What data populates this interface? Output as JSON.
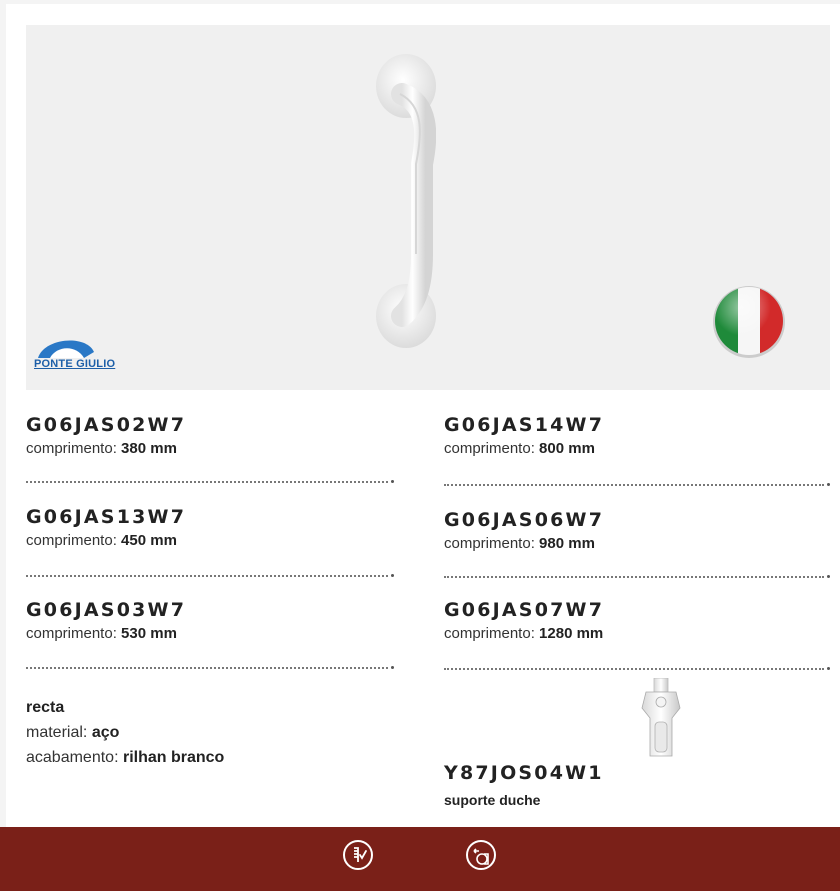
{
  "brand": {
    "logo_text": "PONTE GIULIO",
    "colors": {
      "footer": "#7a2018",
      "logo": "#1d5fa8"
    }
  },
  "products_left": [
    {
      "code": "G06JAS02W7",
      "label": "comprimento:",
      "value": "380 mm"
    },
    {
      "code": "G06JAS13W7",
      "label": "comprimento:",
      "value": "450 mm"
    },
    {
      "code": "G06JAS03W7",
      "label": "comprimento:",
      "value": "530 mm"
    }
  ],
  "products_right": [
    {
      "code": "G06JAS14W7",
      "label": "comprimento:",
      "value": "800 mm"
    },
    {
      "code": "G06JAS06W7",
      "label": "comprimento:",
      "value": "980 mm"
    },
    {
      "code": "G06JAS07W7",
      "label": "comprimento:",
      "value": "1280 mm"
    }
  ],
  "description": {
    "title": "recta",
    "material_label": "material:",
    "material_value": "aço",
    "finish_label": "acabamento:",
    "finish_value": "rilhan branco"
  },
  "accessory": {
    "code": "Y87JOS04W1",
    "label": "suporte duche"
  },
  "footer_icons": [
    "screw-fixing-icon",
    "wall-mount-rotation-icon"
  ]
}
